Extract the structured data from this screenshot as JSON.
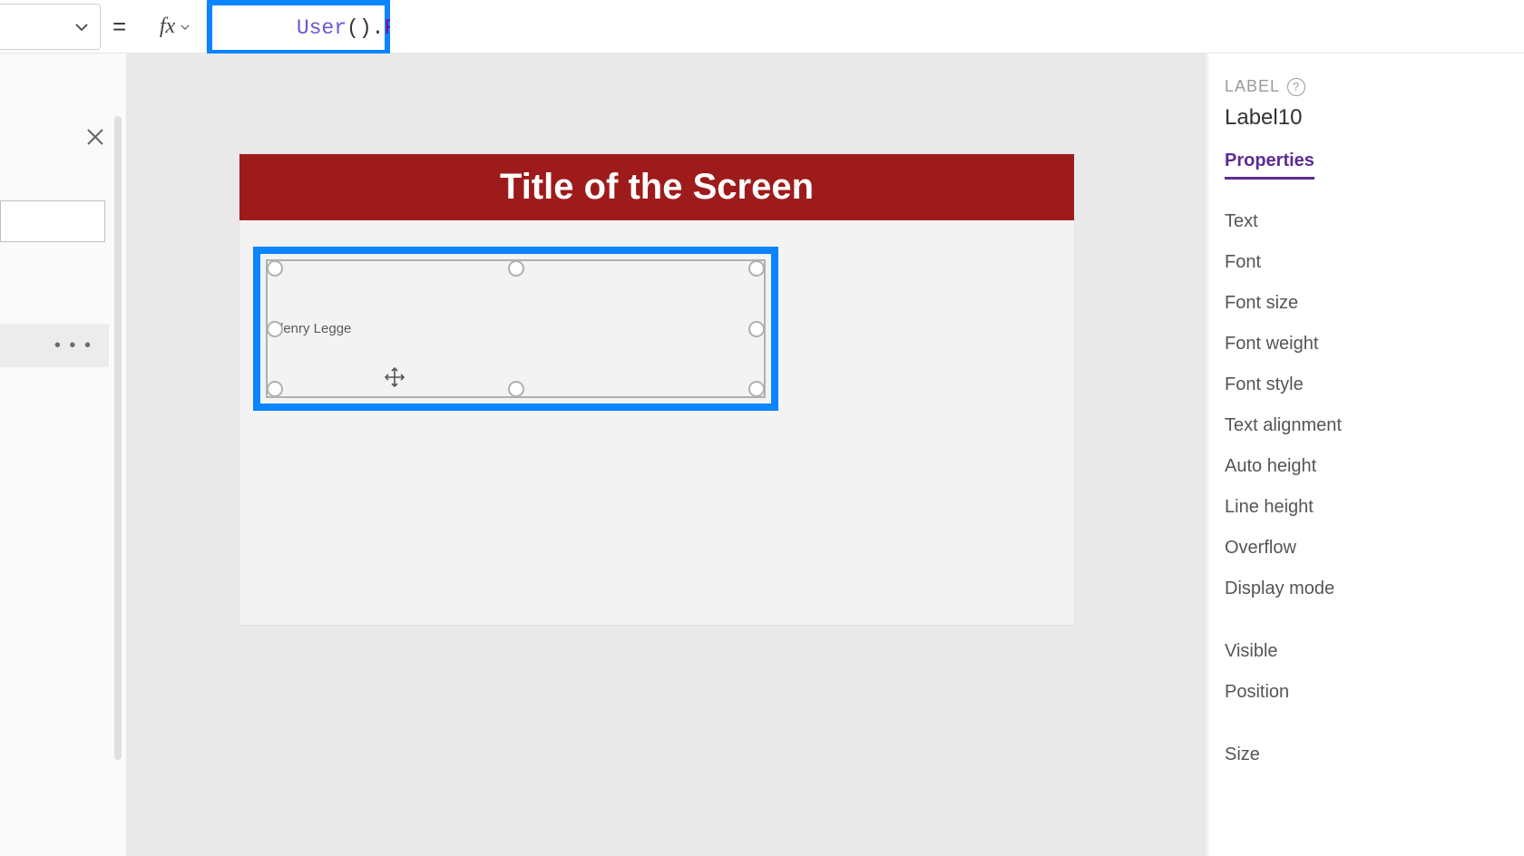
{
  "formula_bar": {
    "equals": "=",
    "fx_label": "fx",
    "property_dropdown": "",
    "formula_tokens": {
      "user": "User",
      "parens": "()",
      "dot": ".",
      "prop": "FullName"
    }
  },
  "tree_panel": {
    "selected_row_ellipsis": "• • •"
  },
  "canvas": {
    "screen_title": "Title of the Screen",
    "label_value": "lenry Legge"
  },
  "props_panel": {
    "heading": "LABEL",
    "help": "?",
    "control_name": "Label10",
    "tabs": {
      "properties": "Properties"
    },
    "items": {
      "text": "Text",
      "font": "Font",
      "font_size": "Font size",
      "font_weight": "Font weight",
      "font_style": "Font style",
      "text_alignment": "Text alignment",
      "auto_height": "Auto height",
      "line_height": "Line height",
      "overflow": "Overflow",
      "display_mode": "Display mode",
      "visible": "Visible",
      "position": "Position",
      "size": "Size"
    }
  }
}
